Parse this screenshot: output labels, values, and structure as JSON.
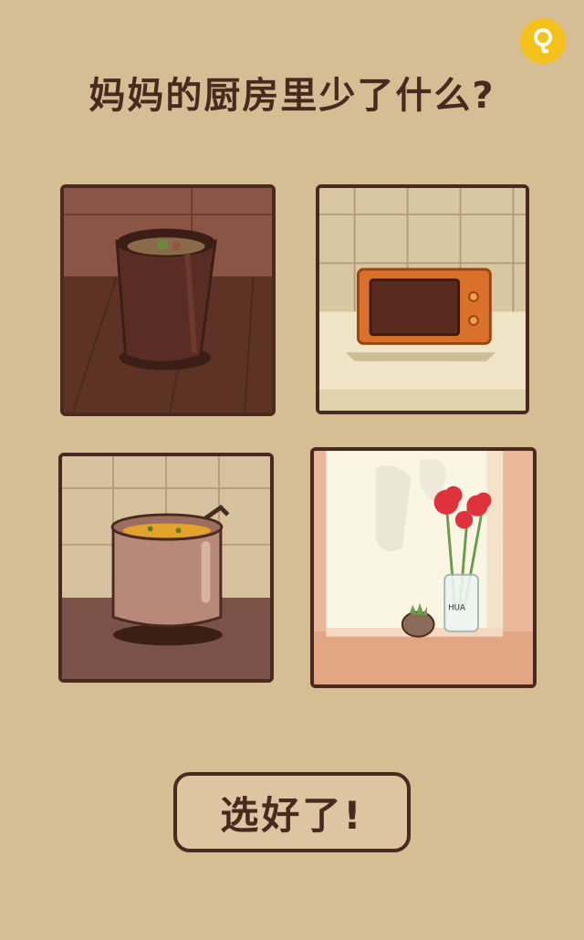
{
  "title": "妈妈的厨房里少了什么?",
  "confirm_label": "选好了!",
  "vase_label": "HUA",
  "colors": {
    "background": "#d5bd94",
    "outline": "#4a2a1f",
    "hint": "#f5c21b",
    "flower": "#e0323a"
  },
  "icons": {
    "hint": "lightbulb-icon"
  },
  "tiles": [
    {
      "name": "trash-can"
    },
    {
      "name": "microwave"
    },
    {
      "name": "cooking-pot"
    },
    {
      "name": "flowers-on-windowsill"
    }
  ]
}
